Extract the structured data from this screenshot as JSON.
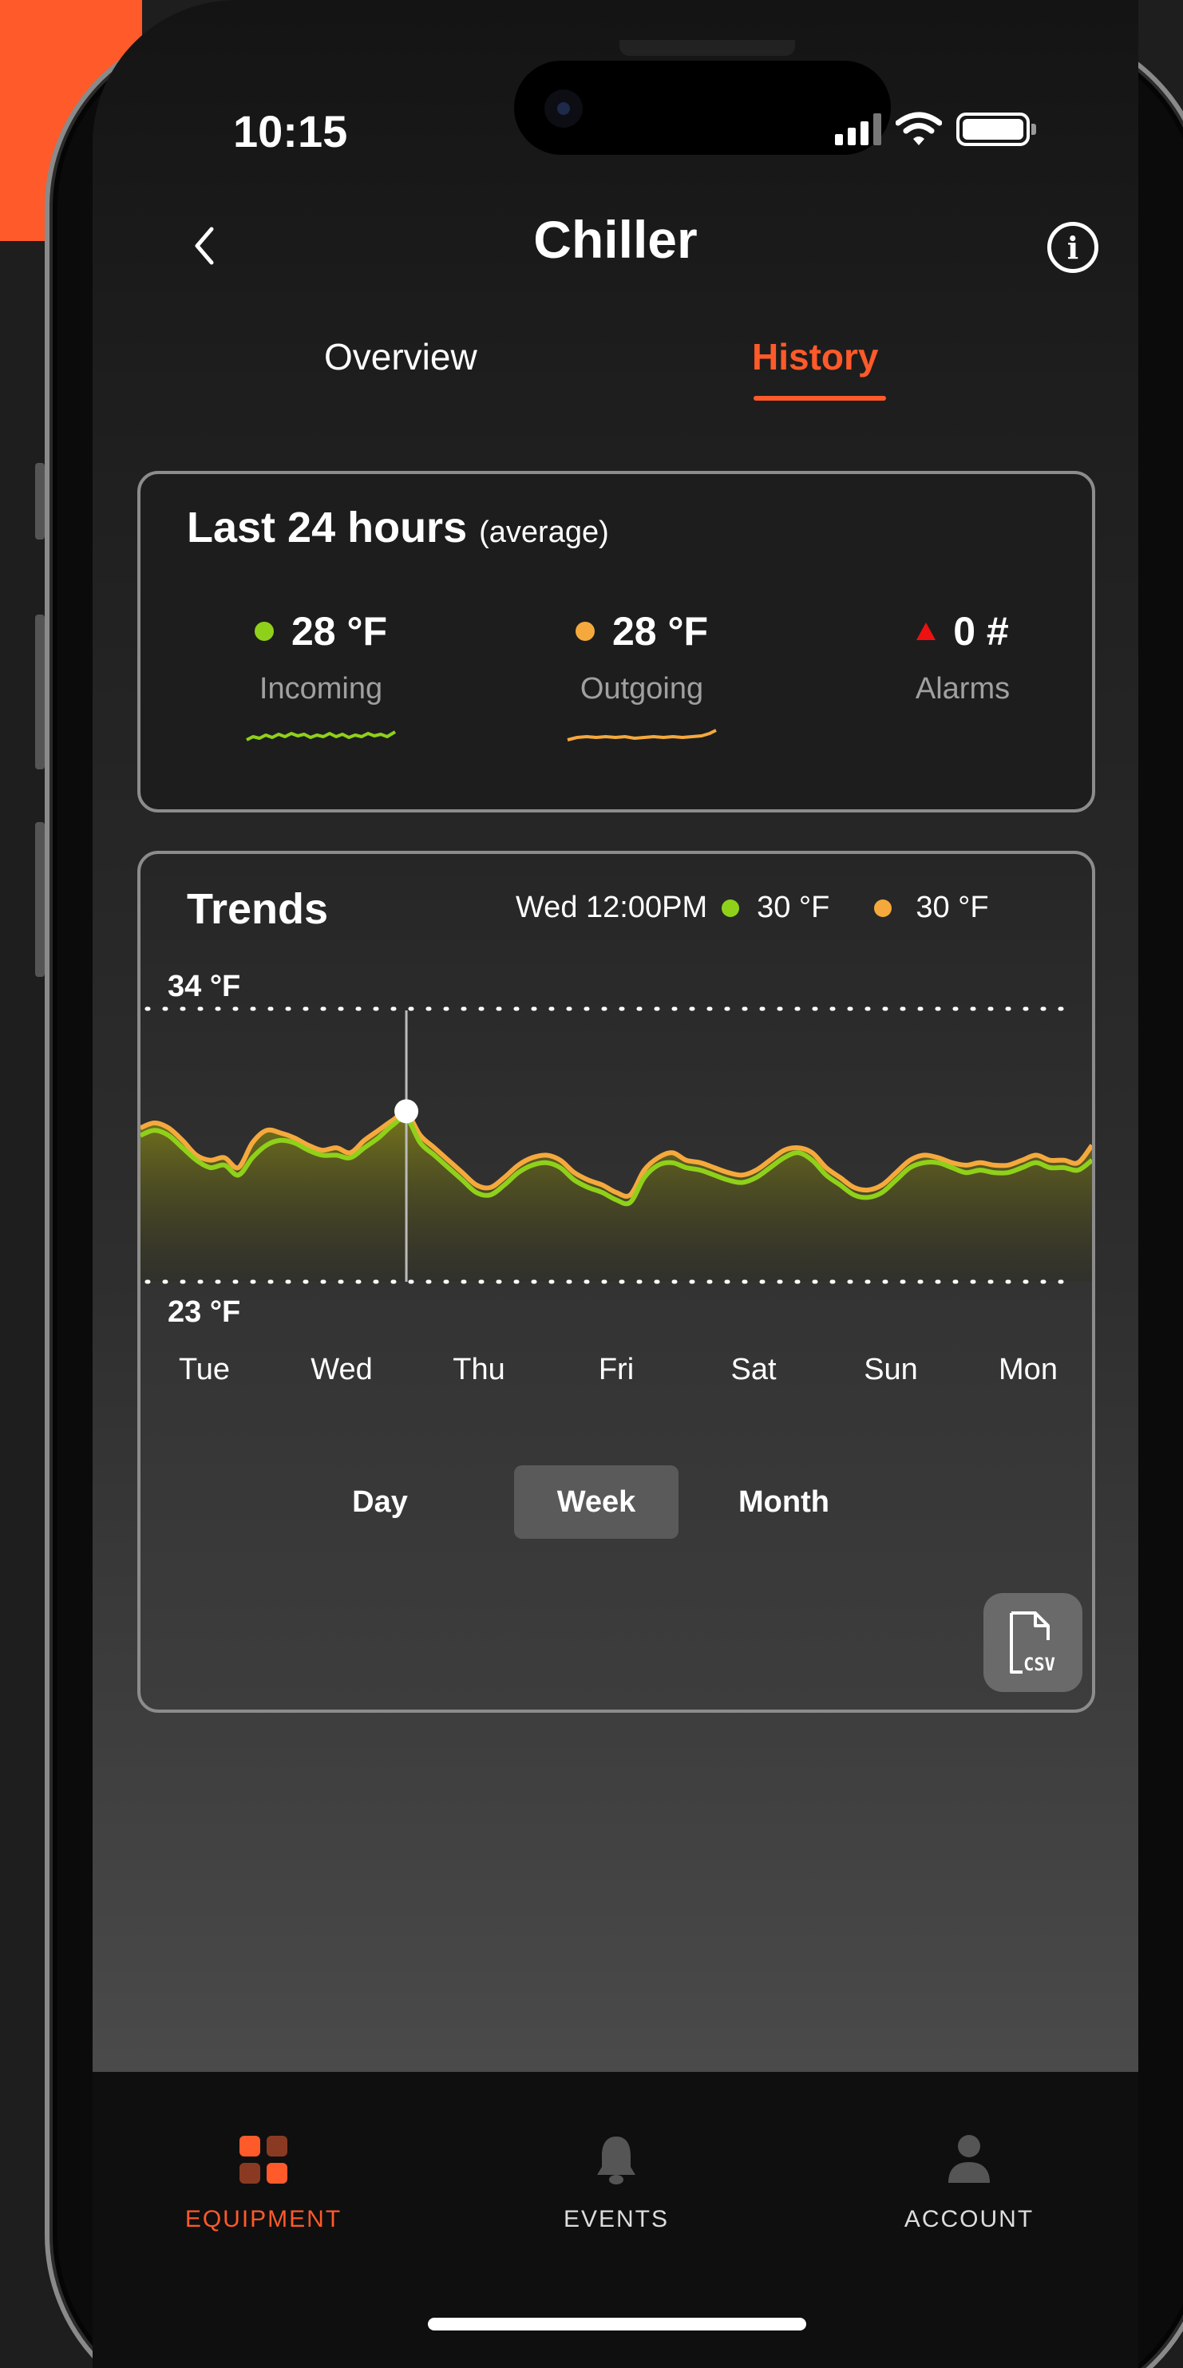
{
  "status_bar": {
    "time": "10:15"
  },
  "header": {
    "title": "Chiller"
  },
  "tabs": [
    {
      "label": "Overview",
      "active": false
    },
    {
      "label": "History",
      "active": true
    }
  ],
  "summary": {
    "title": "Last 24 hours",
    "subtitle": "(average)",
    "metrics": [
      {
        "value": "28 °F",
        "label": "Incoming",
        "color": "#8fd11a"
      },
      {
        "value": "28 °F",
        "label": "Outgoing",
        "color": "#f5a93c"
      },
      {
        "value": "0 #",
        "label": "Alarms",
        "color": "#e11d1d"
      }
    ]
  },
  "trends": {
    "title": "Trends",
    "readout": {
      "time": "Wed 12:00PM",
      "incoming": "30 °F",
      "outgoing": "30 °F"
    },
    "range_tabs": [
      {
        "label": "Day",
        "selected": false
      },
      {
        "label": "Week",
        "selected": true
      },
      {
        "label": "Month",
        "selected": false
      }
    ],
    "csv_label": "CSV"
  },
  "chart_data": {
    "type": "area",
    "ylim": [
      23,
      34
    ],
    "y_tick_labels": [
      "34 °F",
      "23 °F"
    ],
    "categories": [
      "Tue",
      "Wed",
      "Thu",
      "Fri",
      "Sat",
      "Sun",
      "Mon"
    ],
    "grid": "dotted lines at 34 °F and 23 °F",
    "selected_point": {
      "label": "Wed 12:00PM",
      "value": 30
    },
    "series": [
      {
        "color": "#8fd11a",
        "x": [
          0,
          0.1,
          0.2,
          0.3,
          0.4,
          0.5,
          0.6,
          0.7,
          0.8,
          0.9,
          1.0,
          1.1,
          1.2,
          1.3,
          1.4,
          1.5,
          1.6,
          1.7,
          1.8,
          1.9,
          2.0,
          2.1,
          2.2,
          2.3,
          2.4,
          2.5,
          2.6,
          2.7,
          2.8,
          2.9,
          3.0,
          3.1,
          3.2,
          3.3,
          3.4,
          3.5,
          3.6,
          3.7,
          3.8,
          3.9,
          4.0,
          4.1,
          4.2,
          4.3,
          4.4,
          4.5,
          4.6,
          4.7,
          4.8,
          4.9,
          5.0,
          5.1,
          5.2,
          5.3,
          5.4,
          5.5,
          5.6,
          5.7,
          5.8,
          5.9,
          6.0,
          6.1,
          6.2,
          6.3,
          6.4,
          6.5,
          6.6,
          6.7,
          6.8
        ],
        "values": [
          28.9,
          29.1,
          28.9,
          28.4,
          27.9,
          27.6,
          27.7,
          27.3,
          28.0,
          28.5,
          28.7,
          28.6,
          28.3,
          28.1,
          28.1,
          28.0,
          28.4,
          28.8,
          29.3,
          29.6,
          28.6,
          28.1,
          27.6,
          27.1,
          26.6,
          26.5,
          26.9,
          27.4,
          27.7,
          27.8,
          27.6,
          27.1,
          26.8,
          26.6,
          26.3,
          26.2,
          27.2,
          27.7,
          27.8,
          27.6,
          27.5,
          27.3,
          27.1,
          27.0,
          27.2,
          27.6,
          28.0,
          28.2,
          27.9,
          27.3,
          26.9,
          26.5,
          26.4,
          26.6,
          27.1,
          27.6,
          27.8,
          27.8,
          27.6,
          27.4,
          27.5,
          27.4,
          27.4,
          27.6,
          27.8,
          27.6,
          27.6,
          27.5,
          27.9
        ]
      },
      {
        "color": "#f5a93c",
        "x": [
          0,
          0.1,
          0.2,
          0.3,
          0.4,
          0.5,
          0.6,
          0.7,
          0.8,
          0.9,
          1.0,
          1.1,
          1.2,
          1.3,
          1.4,
          1.5,
          1.6,
          1.7,
          1.8,
          1.9,
          2.0,
          2.1,
          2.2,
          2.3,
          2.4,
          2.5,
          2.6,
          2.7,
          2.8,
          2.9,
          3.0,
          3.1,
          3.2,
          3.3,
          3.4,
          3.5,
          3.6,
          3.7,
          3.8,
          3.9,
          4.0,
          4.1,
          4.2,
          4.3,
          4.4,
          4.5,
          4.6,
          4.7,
          4.8,
          4.9,
          5.0,
          5.1,
          5.2,
          5.3,
          5.4,
          5.5,
          5.6,
          5.7,
          5.8,
          5.9,
          6.0,
          6.1,
          6.2,
          6.3,
          6.4,
          6.5,
          6.6,
          6.7,
          6.8
        ],
        "values": [
          29.2,
          29.4,
          29.2,
          28.7,
          28.1,
          27.9,
          28.0,
          27.6,
          28.6,
          29.1,
          29.0,
          28.8,
          28.5,
          28.3,
          28.4,
          28.2,
          28.7,
          29.1,
          29.5,
          29.8,
          28.9,
          28.4,
          27.9,
          27.4,
          26.9,
          26.8,
          27.2,
          27.7,
          28.0,
          28.1,
          27.9,
          27.4,
          27.1,
          26.9,
          26.6,
          26.5,
          27.5,
          28.0,
          28.2,
          27.9,
          27.8,
          27.6,
          27.4,
          27.3,
          27.5,
          27.9,
          28.3,
          28.4,
          28.2,
          27.6,
          27.2,
          26.8,
          26.7,
          26.9,
          27.4,
          27.9,
          28.1,
          28.0,
          27.8,
          27.7,
          27.8,
          27.7,
          27.7,
          27.9,
          28.1,
          27.9,
          27.9,
          27.8,
          28.5
        ]
      }
    ]
  },
  "bottom_nav": [
    {
      "label": "EQUIPMENT",
      "icon": "equipment-grid-icon",
      "active": true
    },
    {
      "label": "EVENTS",
      "icon": "bell-icon",
      "active": false
    },
    {
      "label": "ACCOUNT",
      "icon": "person-icon",
      "active": false
    }
  ],
  "colors": {
    "accent": "#ff5a2a",
    "incoming": "#8fd11a",
    "outgoing": "#f5a93c",
    "alarm": "#e11d1d"
  }
}
